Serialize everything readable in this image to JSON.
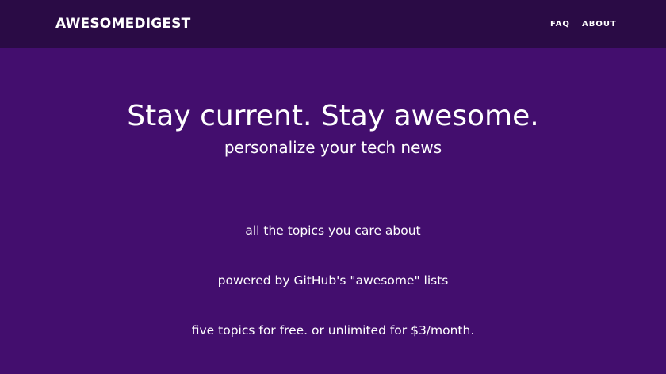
{
  "navbar": {
    "brand": "AWESOMEDIGEST",
    "links": [
      {
        "label": "FAQ"
      },
      {
        "label": "ABOUT"
      }
    ]
  },
  "hero": {
    "title": "Stay current. Stay awesome.",
    "subtitle": "personalize your tech news"
  },
  "features": [
    {
      "text": "all the topics you care about"
    },
    {
      "text": "powered by GitHub's \"awesome\" lists"
    },
    {
      "text": "five topics for free. or unlimited for $3/month."
    }
  ],
  "colors": {
    "navbar_bg": "#2a0b45",
    "page_bg": "#430e6e",
    "text": "#ffffff"
  }
}
